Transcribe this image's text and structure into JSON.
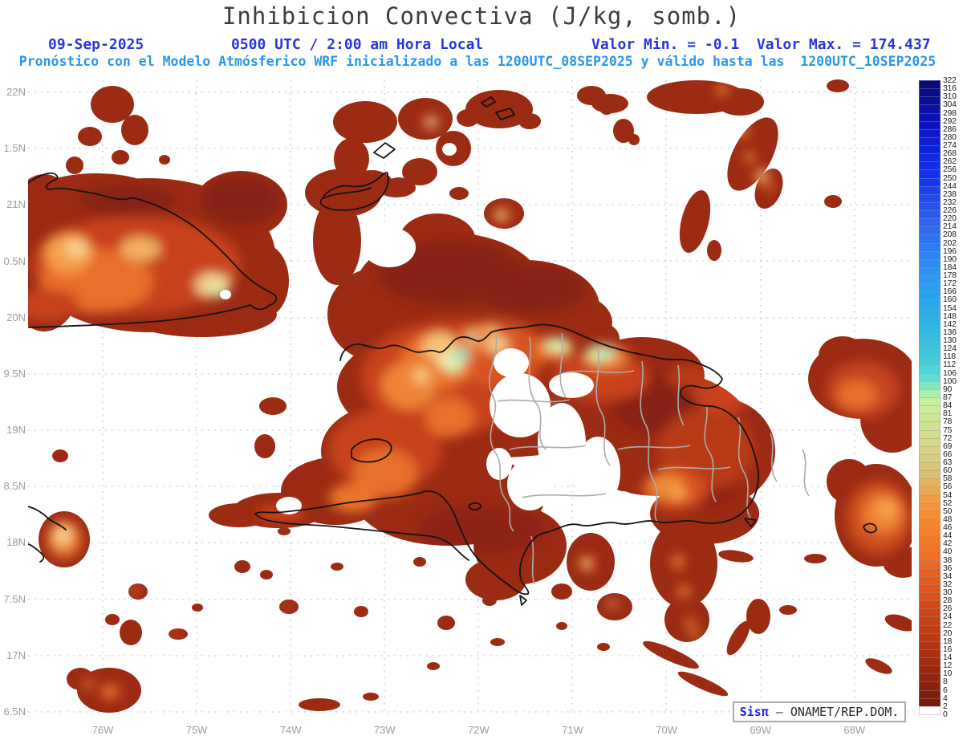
{
  "header": {
    "title": "Inhibicion Convectiva (J/kg, somb.)",
    "date": "09-Sep-2025",
    "time": "0500 UTC / 2:00 am Hora Local",
    "min_max": "Valor Min. = -0.1  Valor Max. = 174.437",
    "forecast_line": "Pronóstico con el Modelo Atmósferico WRF inicializado a las 1200UTC_08SEP2025 y válido hasta las  1200UTC_10SEP2025"
  },
  "axes": {
    "lat": [
      "22N",
      "1.5N",
      "21N",
      "0.5N",
      "20N",
      "9.5N",
      "19N",
      "8.5N",
      "18N",
      "7.5N",
      "17N",
      "6.5N"
    ],
    "lon": [
      "76W",
      "75W",
      "74W",
      "73W",
      "72W",
      "71W",
      "70W",
      "69W",
      "68W"
    ]
  },
  "scale": {
    "labels": [
      322,
      316,
      310,
      304,
      298,
      292,
      286,
      280,
      274,
      268,
      262,
      256,
      250,
      244,
      238,
      232,
      226,
      220,
      214,
      208,
      202,
      196,
      190,
      184,
      178,
      172,
      166,
      160,
      154,
      148,
      142,
      136,
      130,
      124,
      118,
      112,
      106,
      100,
      90,
      87,
      84,
      81,
      78,
      75,
      72,
      69,
      66,
      63,
      60,
      58,
      56,
      54,
      52,
      50,
      48,
      46,
      44,
      42,
      40,
      38,
      36,
      34,
      32,
      30,
      28,
      26,
      24,
      22,
      20,
      18,
      16,
      14,
      12,
      10,
      8,
      6,
      4,
      2,
      0
    ],
    "gradient": [
      [
        0,
        "#0a0a7a"
      ],
      [
        0.07,
        "#0b16c4"
      ],
      [
        0.15,
        "#1535ee"
      ],
      [
        0.22,
        "#2f63f2"
      ],
      [
        0.3,
        "#2f93ef"
      ],
      [
        0.38,
        "#25b6e8"
      ],
      [
        0.44,
        "#3fcddd"
      ],
      [
        0.47,
        "#66ddd0"
      ],
      [
        0.487,
        "#93ecb8"
      ],
      [
        0.5,
        "#c2f2a2"
      ],
      [
        0.56,
        "#d6dd8e"
      ],
      [
        0.62,
        "#d9c172"
      ],
      [
        0.66,
        "#ef9f49"
      ],
      [
        0.7,
        "#f4872f"
      ],
      [
        0.76,
        "#ee6a24"
      ],
      [
        0.81,
        "#dd531e"
      ],
      [
        0.86,
        "#c64117"
      ],
      [
        0.91,
        "#a93012"
      ],
      [
        0.95,
        "#8f250f"
      ],
      [
        1,
        "#6e1709"
      ]
    ],
    "bottom_cell_color": "#ffffff"
  },
  "map": {
    "attribution": {
      "brand": "Sisπ",
      "org": " – ONAMET/REP.DOM."
    },
    "colors": {
      "field_base": "#9c2b14",
      "coastline": "#141414",
      "province_border": "#ababab",
      "grid_dots": "#bcbcbc",
      "tick_labels": "#9c9c9c",
      "header_blue": "#2936db",
      "header_lightblue": "#2a97e8",
      "highlight_orange": "#ee7a2c",
      "highlight_pale_green": "#cdefa8",
      "highlight_cyan": "#8fe3c8"
    }
  },
  "chart_data": {
    "type": "heatmap",
    "title": "Inhibicion Convectiva (J/kg, somb.)",
    "units": "J/kg",
    "value_min": -0.1,
    "value_max": 174.437,
    "valid_date": "09-Sep-2025",
    "valid_time": "0500 UTC / 2:00 am Hora Local",
    "model_run": "1200UTC_08SEP2025",
    "model_end": "1200UTC_10SEP2025",
    "lat_ticks_deg_n": [
      22,
      21.5,
      21,
      20.5,
      20,
      19.5,
      19,
      18.5,
      18,
      17.5,
      17,
      16.5
    ],
    "lon_ticks_deg_w": [
      76,
      75,
      74,
      73,
      72,
      71,
      70,
      69,
      68
    ],
    "scale_levels": [
      0,
      2,
      4,
      6,
      8,
      10,
      12,
      14,
      16,
      18,
      20,
      22,
      24,
      26,
      28,
      30,
      32,
      34,
      36,
      38,
      40,
      42,
      44,
      46,
      48,
      50,
      52,
      54,
      56,
      58,
      60,
      63,
      66,
      69,
      72,
      75,
      78,
      81,
      84,
      87,
      90,
      100,
      106,
      112,
      118,
      124,
      130,
      136,
      142,
      148,
      154,
      160,
      166,
      172,
      178,
      184,
      190,
      196,
      202,
      208,
      214,
      220,
      226,
      232,
      238,
      244,
      250,
      256,
      262,
      268,
      274,
      280,
      286,
      292,
      298,
      304,
      310,
      316,
      322
    ]
  }
}
